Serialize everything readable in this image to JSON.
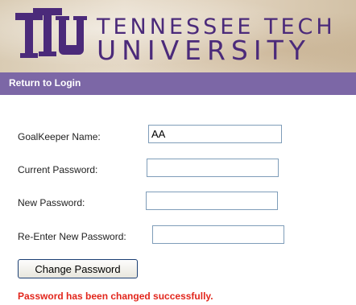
{
  "header": {
    "logo_text": "TTU",
    "university_line1": "TENNESSEE TECH",
    "university_line2": "UNIVERSITY",
    "colors": {
      "brand_purple": "#4b2a7a",
      "nav_purple": "#7c67a6"
    }
  },
  "nav": {
    "return_label": "Return to Login"
  },
  "form": {
    "goalkeeper_label": "GoalKeeper Name:",
    "goalkeeper_value": "AA",
    "current_password_label": "Current Password:",
    "current_password_value": "",
    "new_password_label": "New Password:",
    "new_password_value": "",
    "reenter_password_label": "Re-Enter New Password:",
    "reenter_password_value": "",
    "submit_label": "Change Password"
  },
  "status": {
    "message": "Password has been changed successfully.",
    "color": "#e2261c"
  }
}
